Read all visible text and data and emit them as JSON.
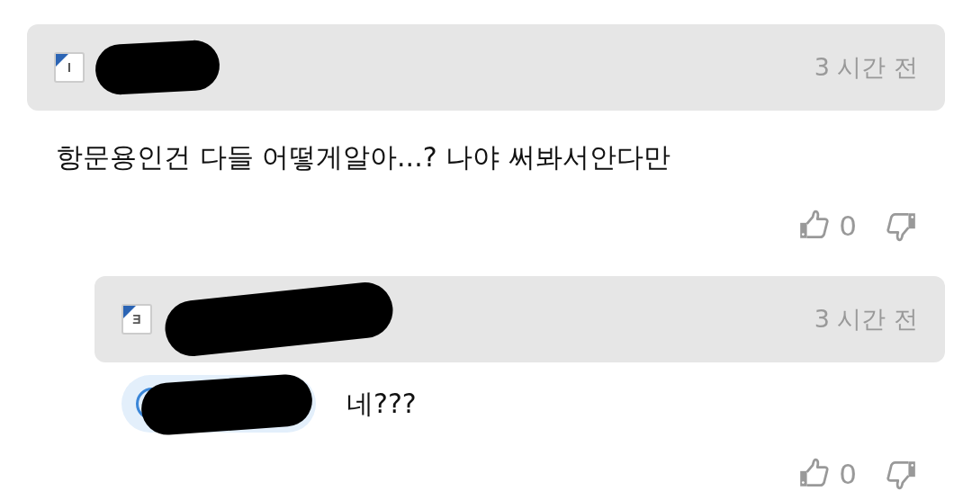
{
  "comments": [
    {
      "level_badge": "I",
      "time": "3 시간 전",
      "text": "항문용인건 다들 어떻게알아...? 나야 써봐서안다만",
      "likes": "0",
      "replies": [
        {
          "level_badge": "Ǝ",
          "time": "3 시간 전",
          "mention": true,
          "text": "네???",
          "likes": "0"
        }
      ]
    }
  ]
}
